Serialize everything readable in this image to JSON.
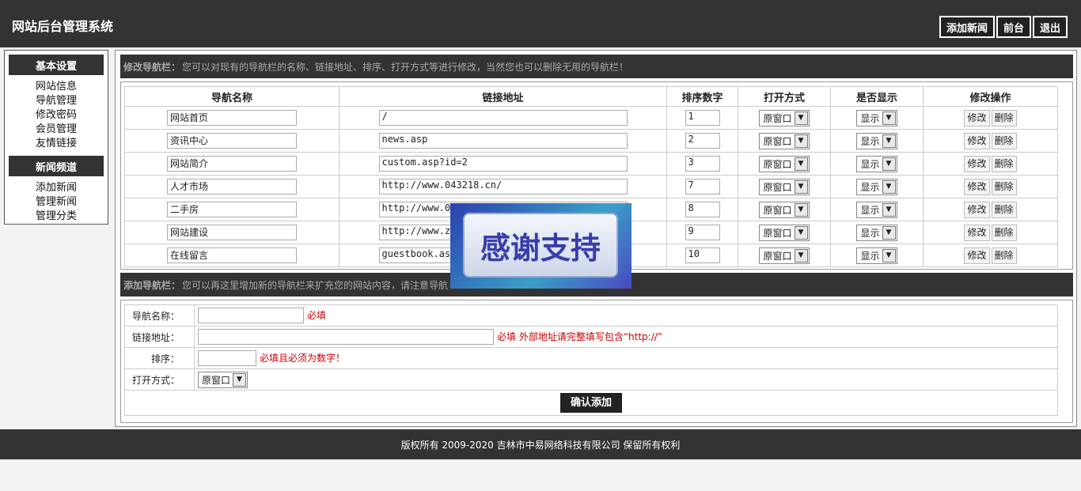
{
  "header": {
    "site_title": "网站后台管理系统",
    "buttons": [
      "添加新闻",
      "前台",
      "退出"
    ]
  },
  "sidebar": {
    "sections": [
      {
        "title": "基本设置",
        "items": [
          "网站信息",
          "导航管理",
          "修改密码",
          "会员管理",
          "友情链接"
        ]
      },
      {
        "title": "新闻频道",
        "items": [
          "添加新闻",
          "管理新闻",
          "管理分类"
        ]
      }
    ]
  },
  "edit_panel": {
    "title": "修改导航栏：",
    "desc": "您可以对现有的导航栏的名称、链接地址、排序、打开方式等进行修改，当然您也可以删除无用的导航栏！",
    "columns": [
      "导航名称",
      "链接地址",
      "排序数字",
      "打开方式",
      "是否显示",
      "修改操作"
    ],
    "rows": [
      {
        "name": "网站首页",
        "url": "/",
        "sort": "1",
        "open": "原窗口",
        "show": "显示"
      },
      {
        "name": "资讯中心",
        "url": "news.asp",
        "sort": "2",
        "open": "原窗口",
        "show": "显示"
      },
      {
        "name": "网站简介",
        "url": "custom.asp?id=2",
        "sort": "3",
        "open": "原窗口",
        "show": "显示"
      },
      {
        "name": "人才市场",
        "url": "http://www.043218.cn/",
        "sort": "7",
        "open": "原窗口",
        "show": "显示"
      },
      {
        "name": "二手房",
        "url": "http://www.043",
        "sort": "8",
        "open": "原窗口",
        "show": "显示"
      },
      {
        "name": "网站建设",
        "url": "http://www.zhon",
        "sort": "9",
        "open": "原窗口",
        "show": "显示"
      },
      {
        "name": "在线留言",
        "url": "guestbook.asp",
        "sort": "10",
        "open": "原窗口",
        "show": "显示"
      }
    ],
    "edit_label": "修改",
    "delete_label": "删除"
  },
  "add_panel": {
    "title": "添加导航栏：",
    "desc": "您可以再这里增加新的导航栏来扩充您的网站内容，请注意导航",
    "name_label": "导航名称：",
    "name_hint": "必填",
    "url_label": "链接地址：",
    "url_hint": "必填  外部地址请完整填写包含“http://”",
    "sort_label": "排序：",
    "sort_hint": "必填且必须为数字！",
    "open_label": "打开方式：",
    "open_value": "原窗口",
    "submit_label": "确认添加"
  },
  "popup": {
    "text": "感谢支持"
  },
  "footer": {
    "text": "版权所有  2009-2020  吉林市中易网络科技有限公司  保留所有权利"
  },
  "colors": {
    "dark": "#333333",
    "required": "#cc0000",
    "background": "#f2f2f2"
  }
}
